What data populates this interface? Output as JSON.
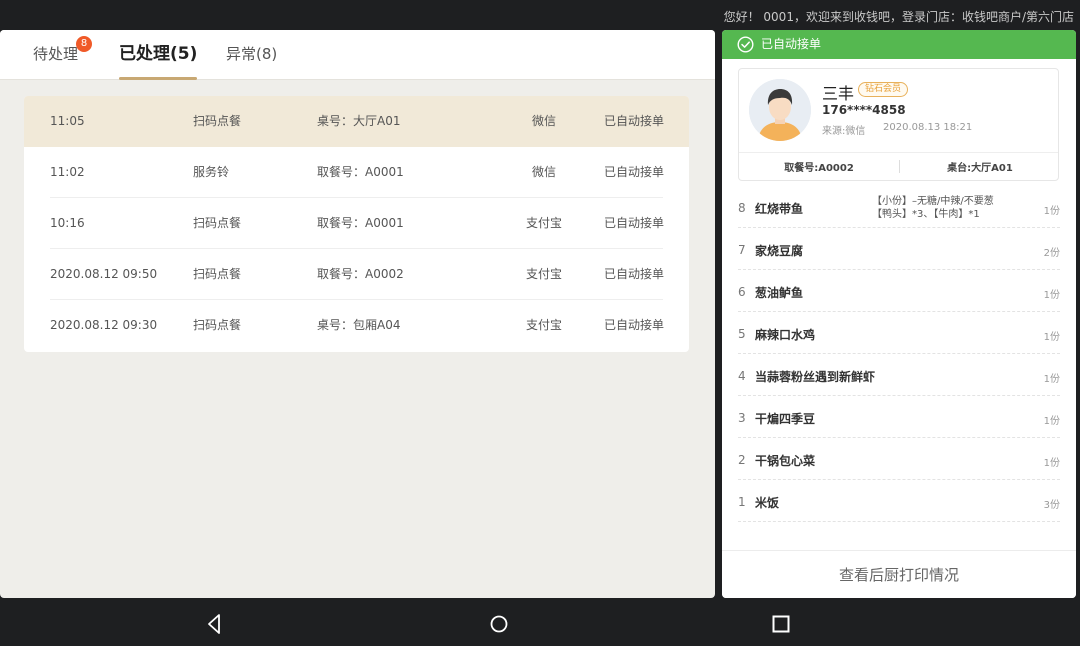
{
  "status_bar": {
    "welcome": "您好！ 0001，欢迎来到收钱吧，登录门店：收钱吧商户/第六门店"
  },
  "tabs": [
    {
      "label": "待处理",
      "badge": "8"
    },
    {
      "label": "已处理(5)"
    },
    {
      "label": "异常(8)"
    }
  ],
  "orders": [
    {
      "time": "11:05",
      "type": "扫码点餐",
      "table": "桌号：大厅A01",
      "pay": "微信",
      "status": "已自动接单"
    },
    {
      "time": "11:02",
      "type": "服务铃",
      "table": "取餐号：A0001",
      "pay": "微信",
      "status": "已自动接单"
    },
    {
      "time": "10:16",
      "type": "扫码点餐",
      "table": "取餐号：A0001",
      "pay": "支付宝",
      "status": "已自动接单"
    },
    {
      "time": "2020.08.12 09:50",
      "type": "扫码点餐",
      "table": "取餐号：A0002",
      "pay": "支付宝",
      "status": "已自动接单"
    },
    {
      "time": "2020.08.12 09:30",
      "type": "扫码点餐",
      "table": "桌号：包厢A04",
      "pay": "支付宝",
      "status": "已自动接单"
    }
  ],
  "detail": {
    "banner": "已自动接单",
    "customer": {
      "name": "三丰",
      "level": "钻石会员",
      "phone": "176****4858",
      "source": "来源:微信",
      "time": "2020.08.13 18:21",
      "pickup_no": "取餐号:A0002",
      "table_no": "桌台:大厅A01"
    },
    "dishes": [
      {
        "idx": "8",
        "name": "红烧带鱼",
        "note1": "【小份】–无糖/中辣/不要葱",
        "note2": "【鸭头】*3、【牛肉】*1",
        "qty": "1份"
      },
      {
        "idx": "7",
        "name": "家烧豆腐",
        "qty": "2份"
      },
      {
        "idx": "6",
        "name": "葱油鲈鱼",
        "qty": "1份"
      },
      {
        "idx": "5",
        "name": "麻辣口水鸡",
        "qty": "1份"
      },
      {
        "idx": "4",
        "name": "当蒜蓉粉丝遇到新鲜虾",
        "qty": "1份"
      },
      {
        "idx": "3",
        "name": "干煸四季豆",
        "qty": "1份"
      },
      {
        "idx": "2",
        "name": "干锅包心菜",
        "qty": "1份"
      },
      {
        "idx": "1",
        "name": "米饭",
        "qty": "3份"
      }
    ],
    "print_button": "查看后厨打印情况"
  },
  "colors": {
    "accent_gold": "#c8a873",
    "selected_row": "#f1e9d8",
    "banner_green": "#55b850",
    "badge_red": "#f05a28"
  }
}
